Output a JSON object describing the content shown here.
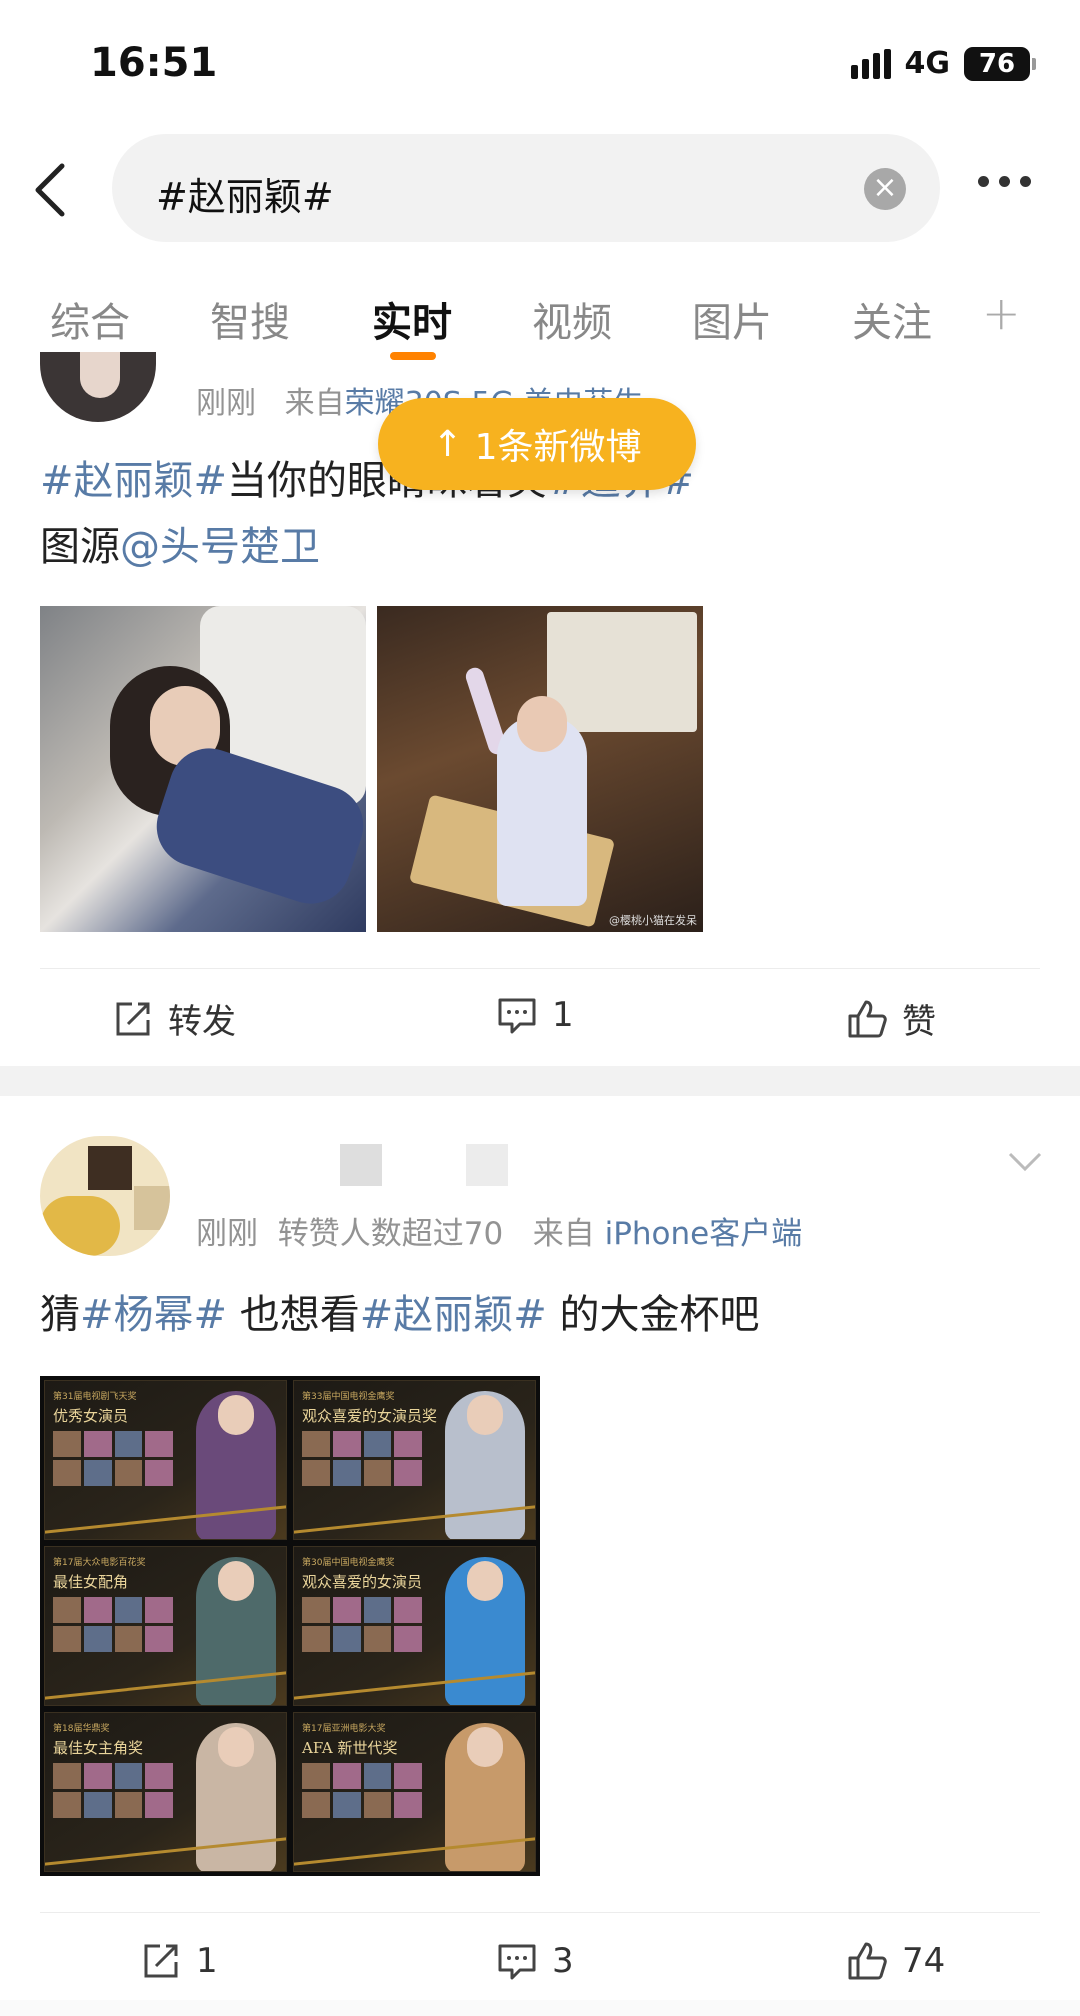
{
  "status": {
    "time": "16:51",
    "network": "4G",
    "battery": "76"
  },
  "search": {
    "query": "#赵丽颖#"
  },
  "tabs": [
    {
      "label": "综合",
      "active": false
    },
    {
      "label": "智搜",
      "active": false
    },
    {
      "label": "实时",
      "active": true
    },
    {
      "label": "视频",
      "active": false
    },
    {
      "label": "图片",
      "active": false
    },
    {
      "label": "关注",
      "active": false
    }
  ],
  "tab_add": "+",
  "toast": {
    "arrow": "↑",
    "label": "1条新微博"
  },
  "post1": {
    "time": "刚刚",
    "source_prefix": "来自",
    "source": "荣耀30S 5G 美史芬生",
    "text_topic1": "#赵丽颖#",
    "text_body": "当你的眼睛眯着笑",
    "text_topic2": "#追界#",
    "text_line2_prefix": "图源",
    "text_mention": "@头号楚卫",
    "image_watermark": "@樱桃小猫在发呆",
    "repost_label": "转发",
    "comment_count": "1",
    "like_label": "赞"
  },
  "post2": {
    "time": "刚刚",
    "likes_note": "转赞人数超过70",
    "source_prefix": "来自",
    "source": "iPhone客户端",
    "text_prefix": "猜",
    "text_topic1": "#杨幂#",
    "text_mid": " 也想看",
    "text_topic2": "#赵丽颖#",
    "text_suffix": " 的大金杯吧",
    "collage": [
      {
        "small": "第31届电视剧飞天奖",
        "title": "优秀女演员"
      },
      {
        "small": "第33届中国电视金鹰奖",
        "title": "观众喜爱的女演员奖"
      },
      {
        "small": "第17届大众电影百花奖",
        "title": "最佳女配角"
      },
      {
        "small": "第30届中国电视金鹰奖",
        "title": "观众喜爱的女演员"
      },
      {
        "small": "第18届华鼎奖",
        "title": "最佳女主角奖"
      },
      {
        "small": "第17届亚洲电影大奖",
        "title": "AFA 新世代奖"
      }
    ],
    "repost_count": "1",
    "comment_count": "3",
    "like_count": "74"
  },
  "colors": {
    "accent": "#ff8200",
    "link": "#587ba6",
    "toast": "#f7b21f",
    "meta": "#939393"
  }
}
